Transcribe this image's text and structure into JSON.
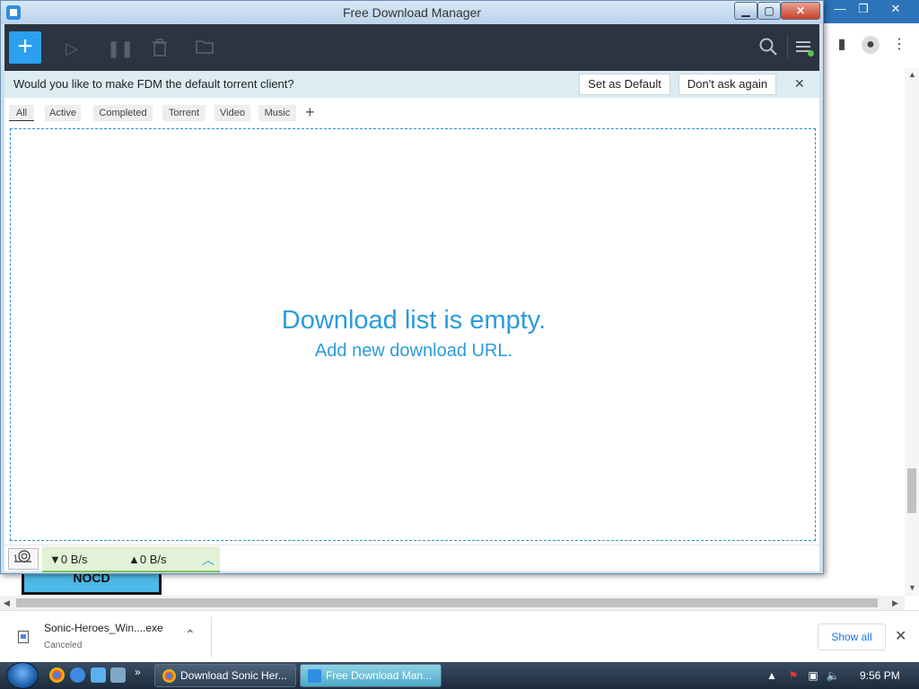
{
  "fdm": {
    "title": "Free Download Manager",
    "notice": {
      "text": "Would you like to make FDM the default torrent client?",
      "set_default_label": "Set as Default",
      "dont_ask_label": "Don't ask again"
    },
    "filter_tabs": [
      {
        "label": "All",
        "selected": true
      },
      {
        "label": "Active"
      },
      {
        "label": "Completed"
      },
      {
        "label": "Torrent"
      },
      {
        "label": "Video"
      },
      {
        "label": "Music"
      }
    ],
    "empty_state": {
      "title": "Download list is empty.",
      "link": "Add new download URL."
    },
    "status": {
      "down_speed": "▼0 B/s",
      "up_speed": "▲0 B/s"
    }
  },
  "background_page": {
    "button_label": "NOCD"
  },
  "download_shelf": {
    "file_name": "Sonic-Heroes_Win....exe",
    "file_status": "Canceled",
    "show_all_label": "Show all"
  },
  "taskbar": {
    "tasks": [
      {
        "label": "Download Sonic Her..."
      },
      {
        "label": "Free Download Man..."
      }
    ],
    "clock": "9:56 PM"
  },
  "colors": {
    "accent": "#2b9bdc",
    "toolbar_bg": "#2b3440",
    "add_button": "#2b9ff0",
    "notice_bg": "#dcecf3",
    "speed_panel_bg": "#e3f2d6"
  },
  "icons": [
    "plus-icon",
    "play-icon",
    "pause-icon",
    "trash-icon",
    "folder-icon",
    "search-icon",
    "hamburger-menu-icon",
    "close-icon",
    "snail-icon",
    "chevron-up-icon"
  ]
}
